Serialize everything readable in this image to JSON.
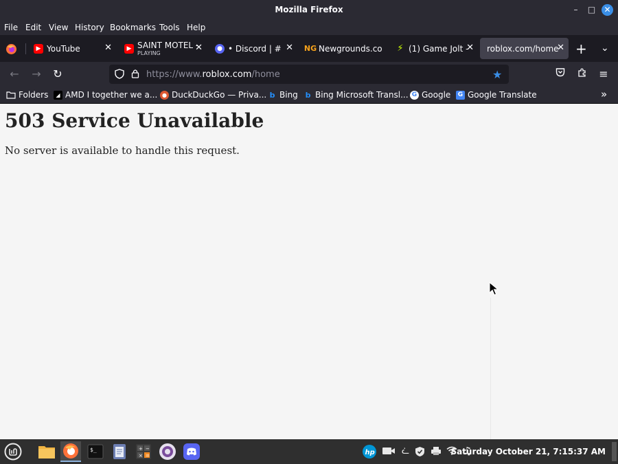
{
  "window": {
    "title": "Mozilla Firefox"
  },
  "menu": [
    "File",
    "Edit",
    "View",
    "History",
    "Bookmarks",
    "Tools",
    "Help"
  ],
  "tabs": [
    {
      "label": "YouTube",
      "sub": "",
      "icon": "youtube-icon"
    },
    {
      "label": "SAINT MOTEL -",
      "sub": "PLAYING",
      "icon": "youtube-icon"
    },
    {
      "label": "• Discord | #",
      "sub": "",
      "icon": "discord-icon"
    },
    {
      "label": "Newgrounds.co",
      "sub": "",
      "icon": "newgrounds-icon"
    },
    {
      "label": "(1) Game Jolt -",
      "sub": "",
      "icon": "gamejolt-icon"
    },
    {
      "label": "roblox.com/home",
      "sub": "",
      "icon": ""
    }
  ],
  "url": {
    "prefix": "https://www.",
    "domain": "roblox.com",
    "path": "/home"
  },
  "bookmarks": [
    {
      "label": "Folders",
      "icon": "folder-icon"
    },
    {
      "label": "AMD I together we a...",
      "icon": "amd-icon"
    },
    {
      "label": "DuckDuckGo — Priva...",
      "icon": "duckduckgo-icon"
    },
    {
      "label": "Bing",
      "icon": "bing-icon"
    },
    {
      "label": "Bing Microsoft Transl...",
      "icon": "bing-icon"
    },
    {
      "label": "Google",
      "icon": "google-icon"
    },
    {
      "label": "Google Translate",
      "icon": "google-translate-icon"
    }
  ],
  "page": {
    "heading": "503 Service Unavailable",
    "message": "No server is available to handle this request."
  },
  "taskbar": {
    "clock": "Saturday October 21, 7:15:37 AM"
  },
  "colors": {
    "chrome_dark": "#2b2a33",
    "tabstrip": "#1c1b22",
    "active_tab": "#42414d",
    "accent": "#3a8ee6",
    "content_bg": "#f5f5f5"
  }
}
